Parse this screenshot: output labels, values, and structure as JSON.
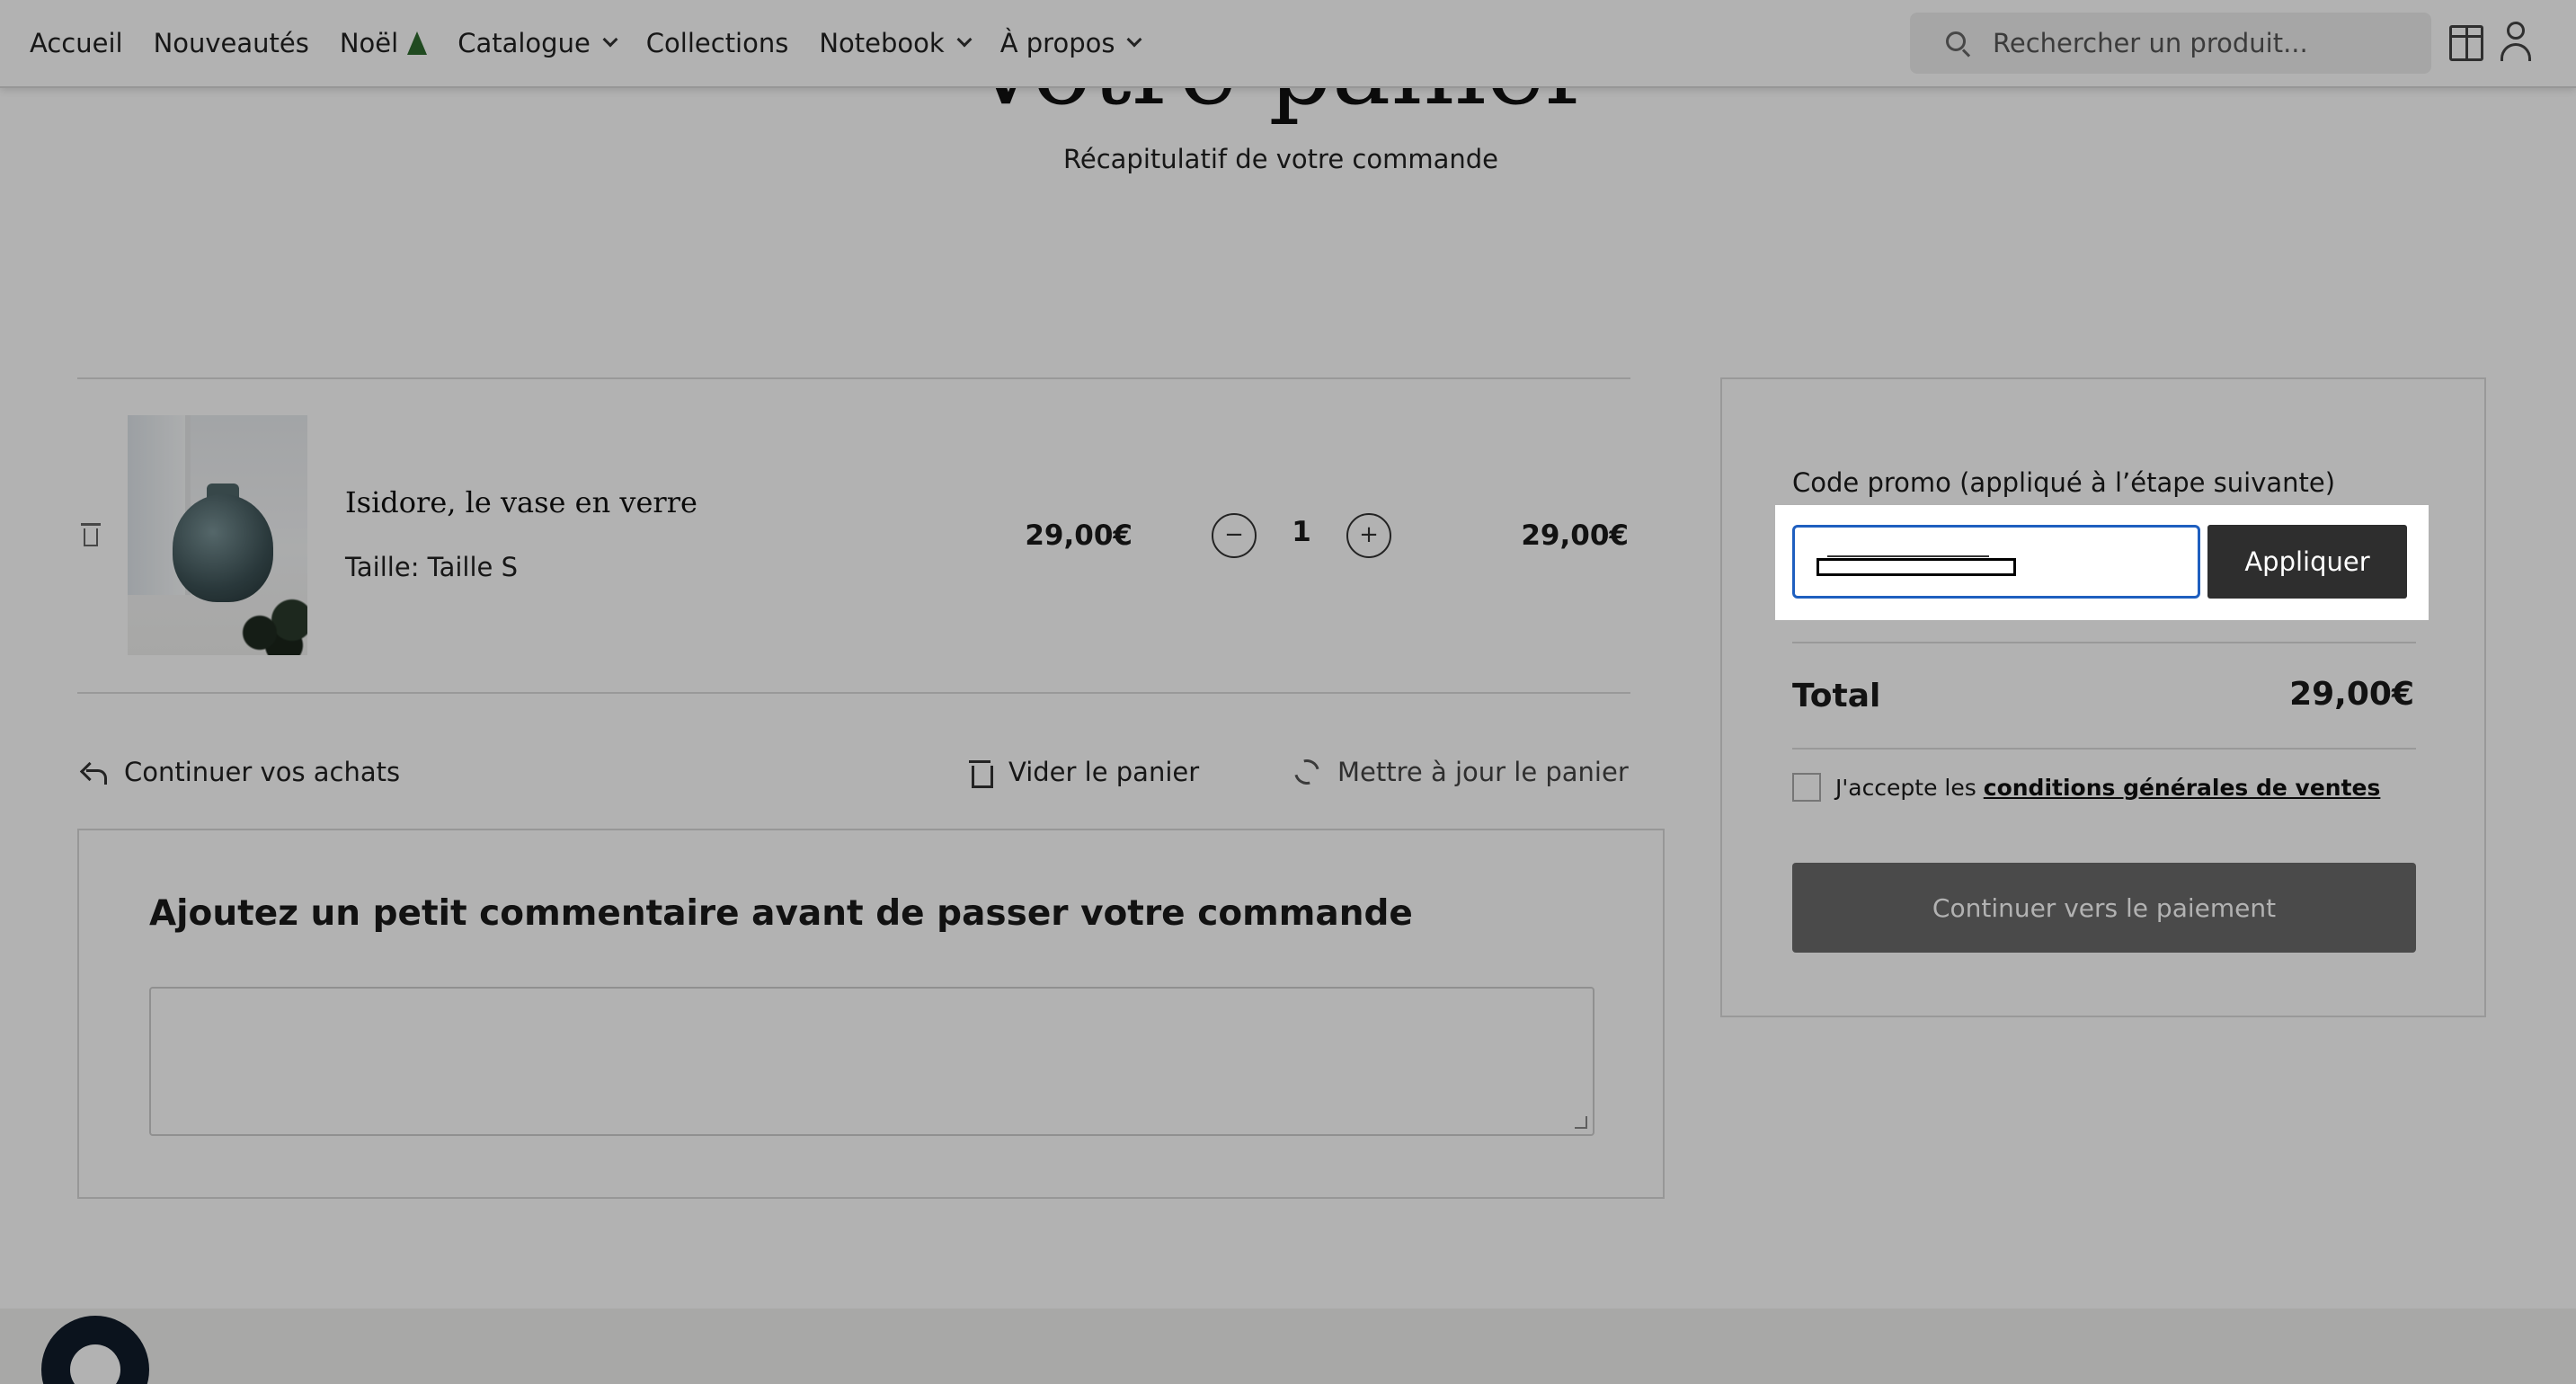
{
  "header": {
    "nav": [
      {
        "label": "Accueil"
      },
      {
        "label": "Nouveautés"
      },
      {
        "label": "Noël"
      },
      {
        "label": "Catalogue"
      },
      {
        "label": "Collections"
      },
      {
        "label": "Notebook"
      },
      {
        "label": "À propos"
      }
    ],
    "search_placeholder": "Rechercher un produit..."
  },
  "page": {
    "title": "Votre panier",
    "subtitle": "Récapitulatif de votre commande"
  },
  "cart": {
    "item": {
      "name": "Isidore, le vase en verre",
      "variant": "Taille: Taille S",
      "unit_price": "29,00€",
      "quantity": "1",
      "line_total": "29,00€"
    },
    "actions": {
      "continue": "Continuer vos achats",
      "empty": "Vider le panier",
      "update": "Mettre à jour le panier"
    },
    "comment_title": "Ajoutez un petit commentaire avant de passer votre commande"
  },
  "summary": {
    "promo_label": "Code promo (appliqué à l’étape suivante)",
    "apply_label": "Appliquer",
    "total_label": "Total",
    "total_value": "29,00€",
    "cgv_prefix": "J'accepte les",
    "cgv_link": "conditions générales de ventes",
    "pay_label": "Continuer vers le paiement"
  }
}
